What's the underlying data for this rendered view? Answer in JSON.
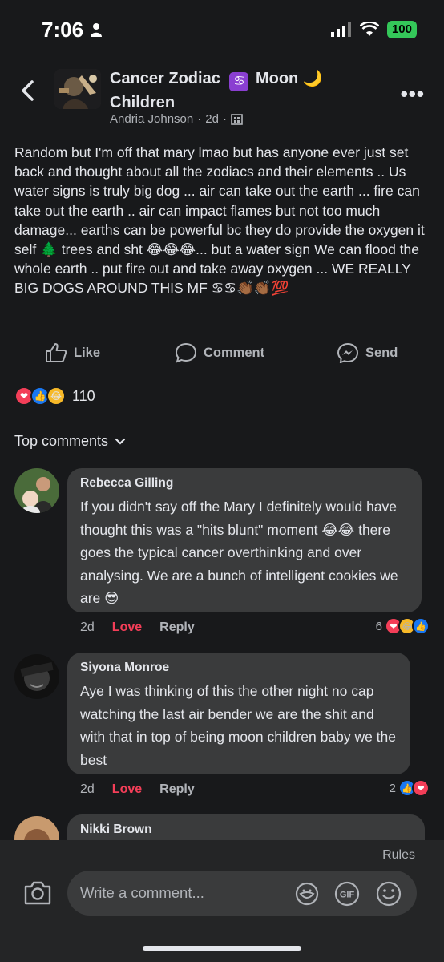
{
  "status": {
    "time": "7:06",
    "battery": "100"
  },
  "header": {
    "title_part1": "Cancer Zodiac",
    "title_symbol": "♋",
    "title_part2": "Moon",
    "title_moon": "🌙",
    "title_line2": "Children",
    "author": "Andria Johnson",
    "separator": "·",
    "time": "2d",
    "separator2": "·"
  },
  "post": {
    "body": "Random but I'm off that mary lmao but has anyone ever just set back and thought about all the zodiacs and their elements  .. Us water signs is truly big dog ... air can take out the earth ... fire can take out the earth .. air can impact flames but not too much damage... earths can be powerful bc they do provide the oxygen it self 🌲 trees and sht 😂😂😂... but a water sign We can flood the whole earth .. put fire out and take away oxygen ... WE REALLY BIG DOGS AROUND THIS MF ♋♋👏🏾👏🏾💯"
  },
  "actions": {
    "like": "Like",
    "comment": "Comment",
    "send": "Send"
  },
  "reactions": {
    "count": "110",
    "icons": [
      "❤",
      "👍",
      "😂"
    ]
  },
  "top_comments_label": "Top comments",
  "comments": [
    {
      "name": "Rebecca Gilling",
      "text": "If you didn't say off the Mary I definitely would have thought this was a \"hits blunt\" moment 😂😂 there goes the typical cancer overthinking and over analysing. We are a bunch of intelligent cookies we are 😎",
      "time": "2d",
      "love": "Love",
      "reply": "Reply",
      "react_count": "6"
    },
    {
      "name": "Siyona Monroe",
      "text": "Aye I was thinking of this the other night no cap watching the last air bender we are the shit and with that in top of being moon children baby we the best",
      "time": "2d",
      "love": "Love",
      "reply": "Reply",
      "react_count": "2"
    },
    {
      "name": "Nikki Brown"
    }
  ],
  "composer": {
    "rules": "Rules",
    "placeholder": "Write a comment..."
  },
  "colors": {
    "background": "#18191b",
    "bubble": "#3a3b3c",
    "love": "#f33e58",
    "like_blue": "#1877f2",
    "battery": "#34c759"
  },
  "icons": [
    "back-arrow-icon",
    "more-icon",
    "like-icon",
    "comment-icon",
    "messenger-icon",
    "chevron-down-icon",
    "camera-icon",
    "sticker-icon",
    "gif-icon",
    "emoji-icon",
    "group-privacy-icon"
  ]
}
